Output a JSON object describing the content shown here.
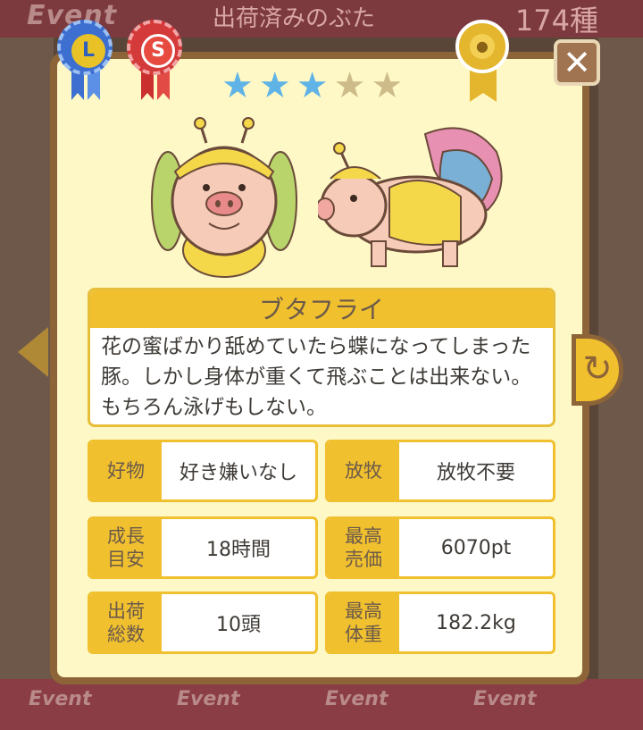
{
  "header": {
    "event_tag": "Event",
    "title": "出荷済みのぶた",
    "count": "174種"
  },
  "footer": {
    "tabs": [
      "Event",
      "Event",
      "Event",
      "Event"
    ]
  },
  "badges": {
    "rosette_l": "L",
    "rosette_s": "S"
  },
  "rating": {
    "stars_filled": 3,
    "stars_total": 5
  },
  "pig": {
    "name": "ブタフライ",
    "description": "花の蜜ばかり舐めていたら蝶になってしまった豚。しかし身体が重くて飛ぶことは出来ない。もちろん泳げもしない。"
  },
  "stats": {
    "favorite_label": "好物",
    "favorite_value": "好き嫌いなし",
    "grazing_label": "放牧",
    "grazing_value": "放牧不要",
    "growth_label": "成長\n目安",
    "growth_value": "18時間",
    "max_price_label": "最高\n売価",
    "max_price_value": "6070pt",
    "shipped_label": "出荷\n総数",
    "shipped_value": "10頭",
    "max_weight_label": "最高\n体重",
    "max_weight_value": "182.2kg"
  },
  "icons": {
    "close": "close-icon",
    "rotate": "rotate-icon",
    "nav_left": "chevron-left-icon",
    "star": "star-icon",
    "medal": "medal-icon",
    "rosette_l": "rosette-l-icon",
    "rosette_s": "rosette-s-icon"
  },
  "colors": {
    "accent": "#f1c02f",
    "card": "#fdf8c6",
    "frame": "#8c6438",
    "star_on": "#5fb3e6",
    "star_off": "#cdbb8a"
  }
}
